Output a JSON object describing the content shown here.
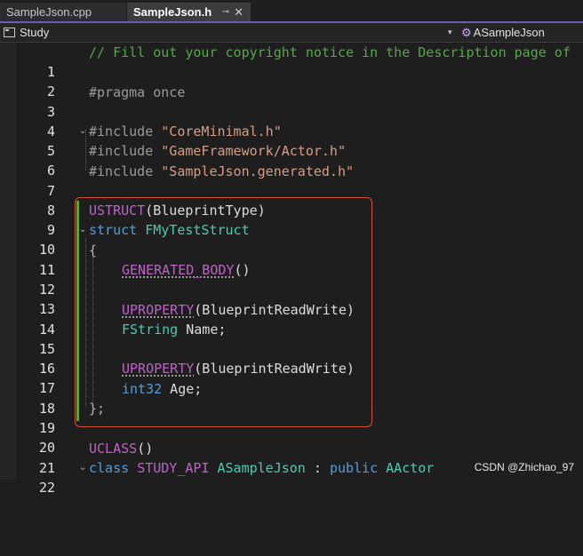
{
  "tabs": [
    {
      "label": "SampleJson.cpp",
      "active": false
    },
    {
      "label": "SampleJson.h",
      "active": true,
      "pin": "⊸",
      "close": "✕"
    }
  ],
  "navbar": {
    "project": "Study",
    "dropdown_glyph": "▾",
    "class_scope": "ASampleJson"
  },
  "colors": {
    "comment": "#57a64a",
    "preprocessor": "#9b9b9b",
    "string": "#d69d85",
    "keyword": "#569cd6",
    "type": "#4ec9b0",
    "macro": "#bd63c5",
    "highlight_border": "#d8502a",
    "change_bar": "#5aa83a",
    "tab_accent": "#6b5fb5"
  },
  "lines": [
    {
      "n": "1"
    },
    {
      "n": "2"
    },
    {
      "n": "3"
    },
    {
      "n": "4"
    },
    {
      "n": "5"
    },
    {
      "n": "6"
    },
    {
      "n": "7"
    },
    {
      "n": "8"
    },
    {
      "n": "9"
    },
    {
      "n": "10"
    },
    {
      "n": "11"
    },
    {
      "n": "12"
    },
    {
      "n": "13"
    },
    {
      "n": "14"
    },
    {
      "n": "15"
    },
    {
      "n": "16"
    },
    {
      "n": "17"
    },
    {
      "n": "18"
    },
    {
      "n": "19"
    },
    {
      "n": "20"
    },
    {
      "n": "21"
    },
    {
      "n": "22"
    }
  ],
  "code": {
    "l1": "// Fill out your copyright notice in the Description page of",
    "l3": "#pragma once",
    "l5_dir": "#include ",
    "l5_str": "\"CoreMinimal.h\"",
    "l6_dir": "#include ",
    "l6_str": "\"GameFramework/Actor.h\"",
    "l7_dir": "#include ",
    "l7_str": "\"SampleJson.generated.h\"",
    "l9_macro": "USTRUCT",
    "l9_rest": "(BlueprintType)",
    "l10_kw": "struct",
    "l10_type": "FMyTestStruct",
    "l11": "{",
    "l12_macro": "GENERATED_BODY",
    "l12_rest": "()",
    "l14_macro": "UPROPERTY",
    "l14_rest": "(BlueprintReadWrite)",
    "l15_type": "FString",
    "l15_rest": " Name;",
    "l17_macro": "UPROPERTY",
    "l17_rest": "(BlueprintReadWrite)",
    "l18_kw": "int32",
    "l18_rest": " Age;",
    "l19": "};",
    "l21_macro": "UCLASS",
    "l21_rest": "()",
    "l22_kw1": "class",
    "l22_macro": "STUDY_API",
    "l22_type": "ASampleJson",
    "l22_colon": " : ",
    "l22_kw2": "public",
    "l22_base": "AActor"
  },
  "fold_glyph": "⌄",
  "watermark": "CSDN @Zhichao_97"
}
